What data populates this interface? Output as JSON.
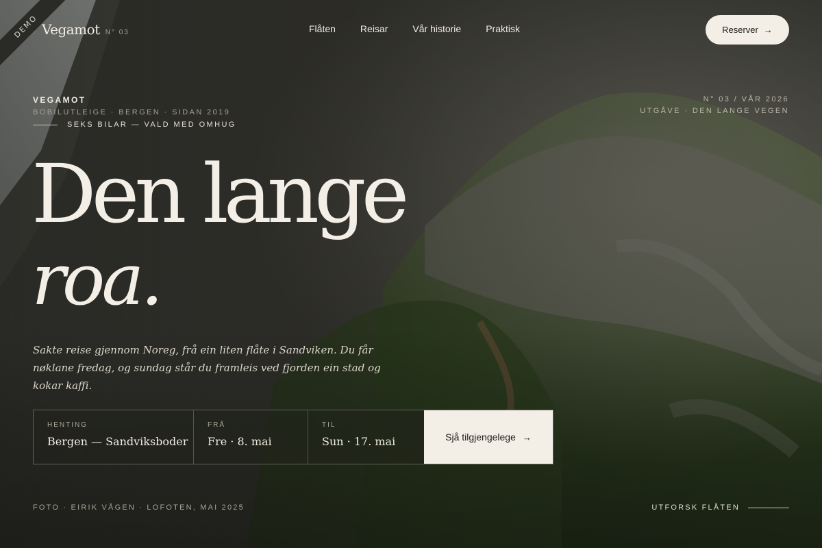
{
  "ribbon": {
    "label": "DEMO"
  },
  "header": {
    "logo_name": "Vegamot",
    "logo_issue": "N° 03",
    "nav": [
      {
        "label": "Flåten"
      },
      {
        "label": "Reisar"
      },
      {
        "label": "Vår historie"
      },
      {
        "label": "Praktisk"
      }
    ],
    "cta_label": "Reserver"
  },
  "meta_left": {
    "brand": "VEGAMOT",
    "subtitle": "BOBILUTLEIGE · BERGEN · SIDAN 2019",
    "tagline": "SEKS BILAR — VALD MED OMHUG"
  },
  "meta_right": {
    "issue": "N° 03 / VÅR 2026",
    "edition": "UTGÅVE · DEN LANGE VEGEN"
  },
  "hero": {
    "line1": "Den lange",
    "line2": "roa."
  },
  "lede": "Sakte reise gjennom Noreg, frå ein liten flåte i Sandviken. Du får nøklane fredag, og sundag står du framleis ved fjorden ein stad og kokar kaffi.",
  "booking": {
    "pickup_label": "HENTING",
    "pickup_value": "Bergen — Sandviksboder",
    "from_label": "FRÅ",
    "from_value": "Fre · 8. mai",
    "to_label": "TIL",
    "to_value": "Sun · 17. mai",
    "submit_label": "Sjå tilgjengelege"
  },
  "footer": {
    "credit": "FOTO · EIRIK VÅGEN · LOFOTEN, MAI 2025",
    "explore_label": "UTFORSK FLÅTEN"
  },
  "icons": {
    "arrow": "→"
  },
  "colors": {
    "accent_light": "#f3efe6",
    "moss_green": "#3f5a26",
    "rock_dark": "#2e2f2a"
  }
}
